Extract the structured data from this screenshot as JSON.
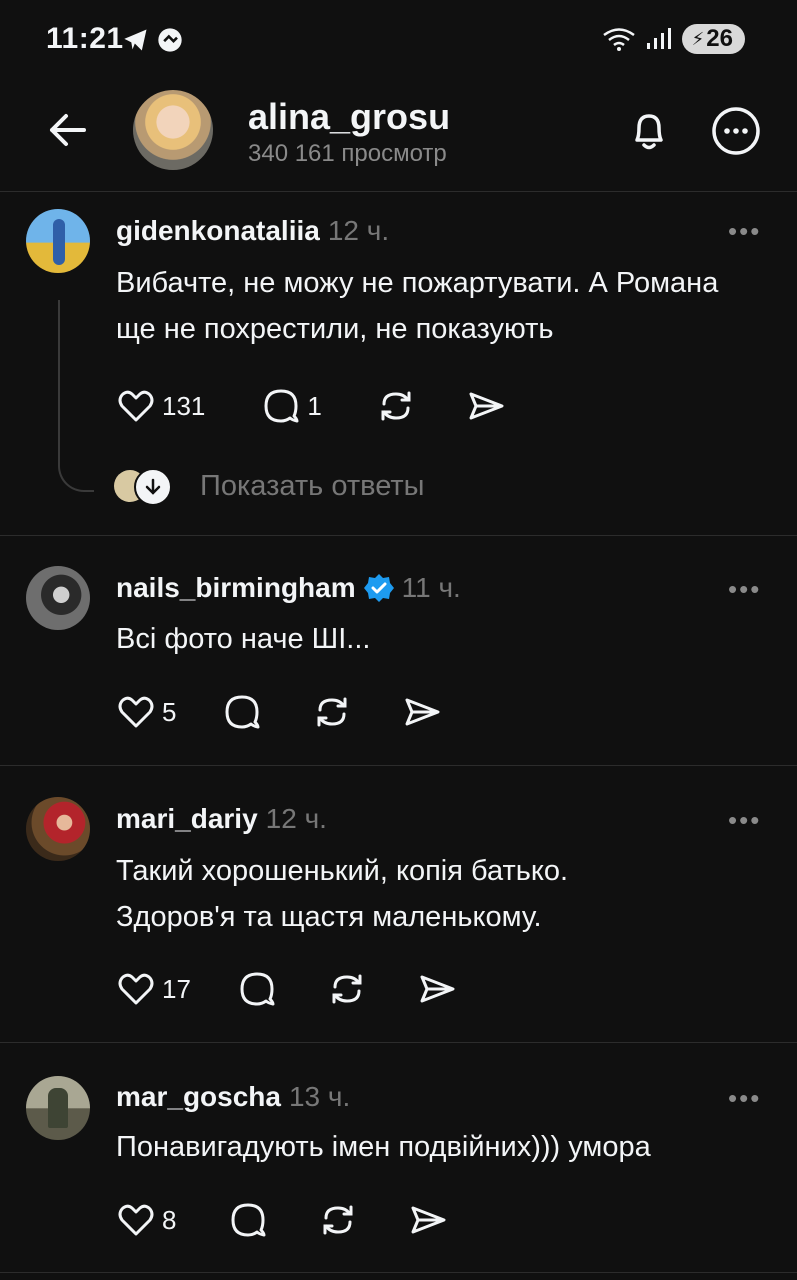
{
  "status": {
    "time": "11:21",
    "battery": "26"
  },
  "header": {
    "username": "alina_grosu",
    "views": "340 161 просмотр"
  },
  "posts": [
    {
      "username": "gidenkonataliia",
      "time": "12 ч.",
      "text": "Вибачте,  не можу не пожартувати. А Романа ще не похрестили, не показують",
      "likes": "131",
      "replies": "1",
      "show_replies": "Показать ответы"
    },
    {
      "username": "nails_birmingham",
      "verified": true,
      "time": "11 ч.",
      "text": "Всі фото наче ШІ...",
      "likes": "5",
      "replies": ""
    },
    {
      "username": "mari_dariy",
      "time": "12 ч.",
      "text": "Такий хорошенький, копія батько. Здоров'я та щастя маленькому.",
      "likes": "17",
      "replies": ""
    },
    {
      "username": "mar_goscha",
      "time": "13 ч.",
      "text": "Понавигадують імен подвійних))) умора",
      "likes": "8",
      "replies": ""
    }
  ],
  "icons": {
    "back": "arrow-left-icon",
    "bell": "bell-icon",
    "more": "more-circle-icon",
    "like": "heart-icon",
    "reply": "comment-icon",
    "repost": "repost-icon",
    "share": "share-icon",
    "verified_color": "#1d9bf0"
  }
}
